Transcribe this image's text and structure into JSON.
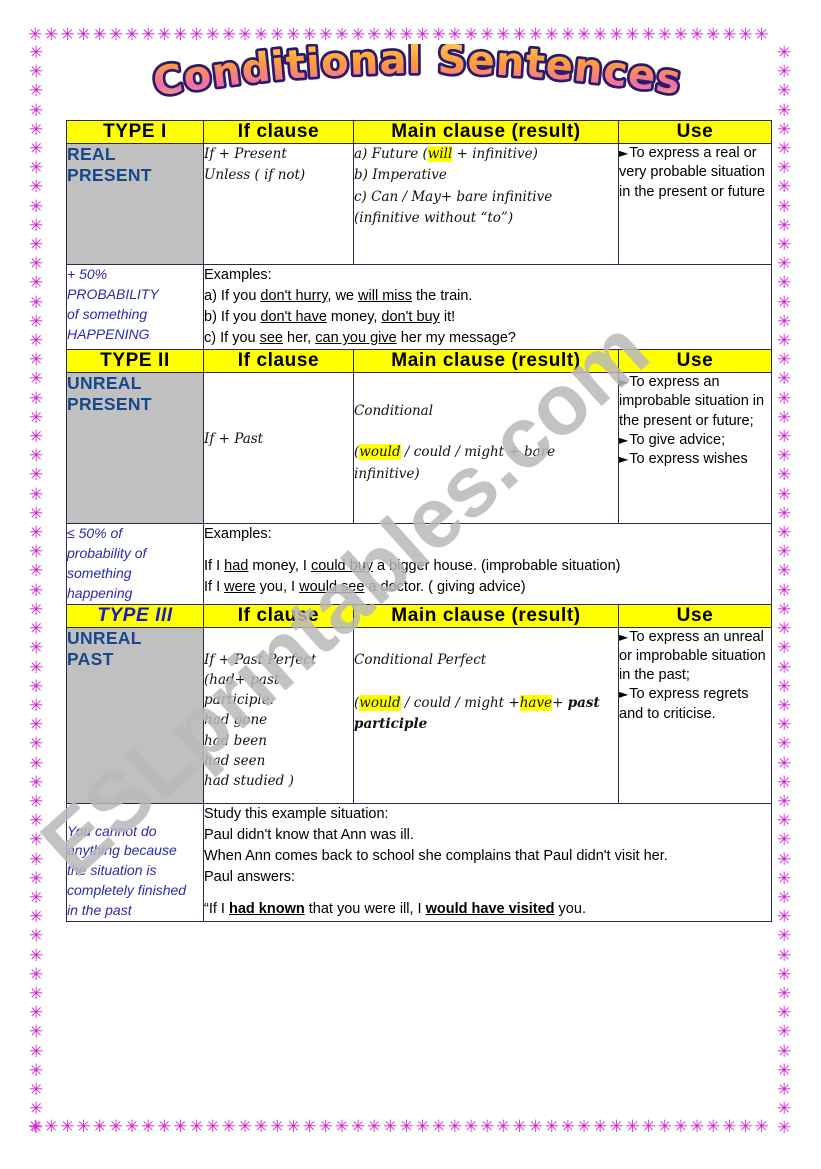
{
  "page": {
    "title": "Conditional Sentences",
    "watermark": "ESLprintables.com",
    "border_glyph": "✳",
    "colors": {
      "header_bg": "#ffff00",
      "type_label_bg": "#c0c0c0",
      "type_label_text": "#19478c",
      "type3_text": "#1919c8",
      "probability_text": "#2a2ab4",
      "border_star": "#d41fd4",
      "grid_line": "#2b2b4f",
      "highlight": "#ffff00",
      "watermark": "#b9b9b9"
    }
  },
  "columns": {
    "col1_type1": "TYPE  I",
    "col1_type2": "TYPE  II",
    "col1_type3": "TYPE  III",
    "col2": "If  clause",
    "col3": "Main  clause (result)",
    "col4": "Use"
  },
  "type1": {
    "label_line1": "REAL",
    "label_line2": "PRESENT",
    "if_clause": [
      "If +  Present",
      "Unless  ( if not)"
    ],
    "main_clause": {
      "line_a_pre": "a) Future (",
      "line_a_hl": "will",
      "line_a_post": " + infinitive)",
      "line_b": "b) Imperative",
      "line_c": "c) Can / May+ bare infinitive",
      "line_d": "(infinitive without “to”)"
    },
    "use": [
      "To express a real or very probable situation in the present or future"
    ],
    "probability": [
      "+ 50%",
      "PROBABILITY",
      "of something",
      "HAPPENING"
    ],
    "examples_heading": "Examples:",
    "examples": [
      {
        "pre": "a) If you ",
        "u1": "don't hurry",
        "mid": ", we ",
        "u2": "will miss",
        "post": " the train."
      },
      {
        "pre": "b) If you ",
        "u1": "don't have",
        "mid": " money, ",
        "u2": "don't buy",
        "post": " it!"
      },
      {
        "pre": "c) If you ",
        "u1": "see",
        "mid": " her, ",
        "u2": "can you give",
        "post": " her my message?"
      }
    ]
  },
  "type2": {
    "label_line1": "UNREAL",
    "label_line2": "PRESENT",
    "if_clause": [
      "If + Past"
    ],
    "main_clause": {
      "line_1": "Conditional",
      "line_2_pre": "(",
      "line_2_hl": "would",
      "line_2_post": " / could / might  + bare infinitive)"
    },
    "use": [
      "To express an improbable situation in the present or future;",
      "To give advice;",
      "To express wishes"
    ],
    "probability": [
      "≤ 50% of",
      "probability of",
      "something",
      "happening"
    ],
    "examples_heading": "Examples:",
    "examples": [
      {
        "pre": "If I ",
        "u1": "had",
        "mid": " money, I ",
        "u2": "could buy",
        "post": " a bigger house. (improbable situation)"
      },
      {
        "pre": "If I ",
        "u1": "were",
        "mid": " you, I ",
        "u2": "would see",
        "post": " a doctor. ( giving advice)"
      }
    ]
  },
  "type3": {
    "label_line1": "UNREAL",
    "label_line2": "PAST",
    "if_clause": [
      "If +  Past Perfect",
      "(had+ past",
      "participle:",
      "had gone",
      "had been",
      "had seen",
      "had studied )"
    ],
    "main_clause": {
      "line_1": "Conditional  Perfect",
      "line_2_pre": "(",
      "line_2_hl1": "would",
      "line_2_mid": " / could / might  +",
      "line_2_hl2": "have",
      "line_2_post": "+ ",
      "line_2_bold": "past participle"
    },
    "use": [
      "To express an unreal or improbable situation in the past;",
      "To express regrets and to criticise."
    ],
    "probability": [
      "You cannot do",
      "anything because",
      "the situation is",
      "completely finished",
      "in the past"
    ],
    "study_lines": [
      "Study this example situation:",
      "Paul didn't know that Ann was ill.",
      "When Ann comes back to school she complains that Paul didn't visit her.",
      "Paul answers:"
    ],
    "quote": {
      "pre": "“If I ",
      "b1": "had known",
      "mid": " that you were ill, I ",
      "b2": "would have visited",
      "post": " you."
    }
  }
}
